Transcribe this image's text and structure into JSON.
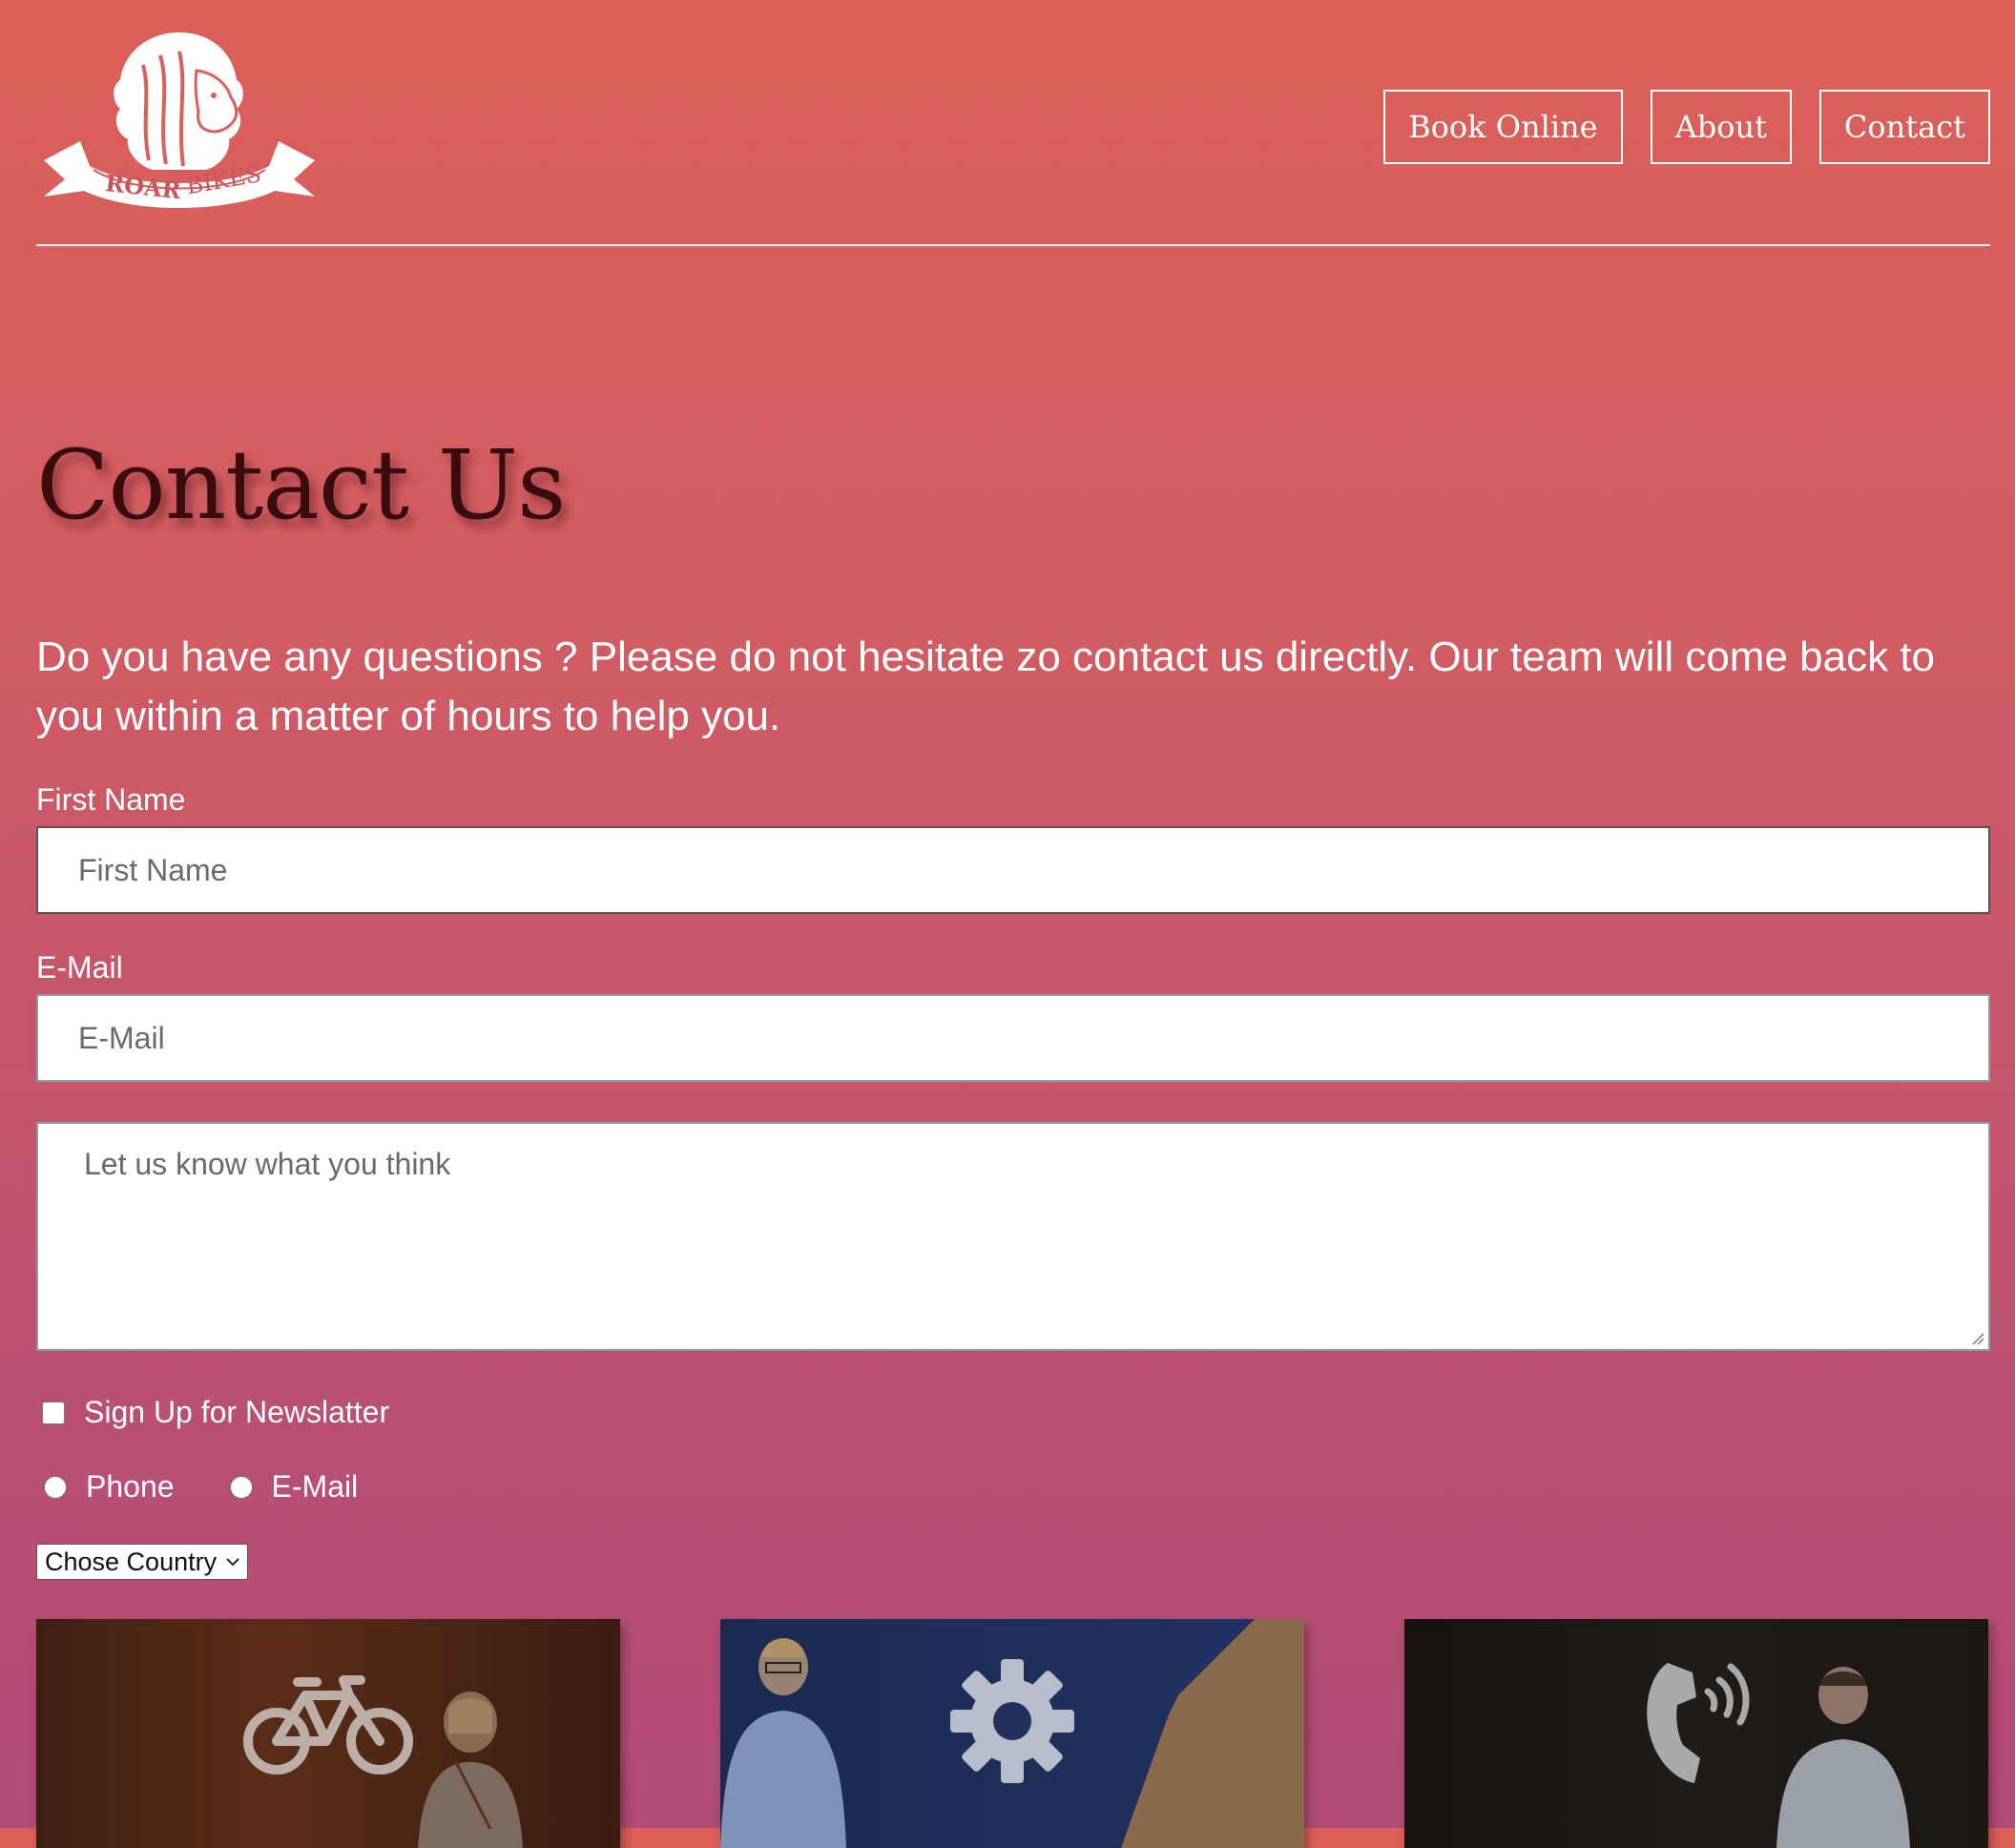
{
  "brand": {
    "name_part1": "ROAR",
    "name_part2": "BIKES"
  },
  "nav": {
    "book_online": "Book Online",
    "about": "About",
    "contact": "Contact"
  },
  "page": {
    "title": "Contact Us",
    "intro": "Do you have any questions ? Please do not hesitate zo contact us directly. Our team will come back to you within a matter of hours to help you."
  },
  "form": {
    "first_name_label": "First Name",
    "first_name_placeholder": "First Name",
    "email_label": "E-Mail",
    "email_placeholder": "E-Mail",
    "message_placeholder": "Let us know what you think",
    "newsletter_label": "Sign Up for Newslatter",
    "contact_options": [
      "Phone",
      "E-Mail"
    ],
    "country_select": "Chose Country"
  },
  "cards": [
    {
      "icon": "bicycle-icon",
      "background": "#4a2616"
    },
    {
      "icon": "gear-icon",
      "background": "#1e2c52"
    },
    {
      "icon": "phone-icon",
      "background": "#1f1a17"
    }
  ],
  "colors": {
    "gradient_top": "#dc6059",
    "gradient_bottom": "#b24b78",
    "title": "#3a0c10"
  }
}
